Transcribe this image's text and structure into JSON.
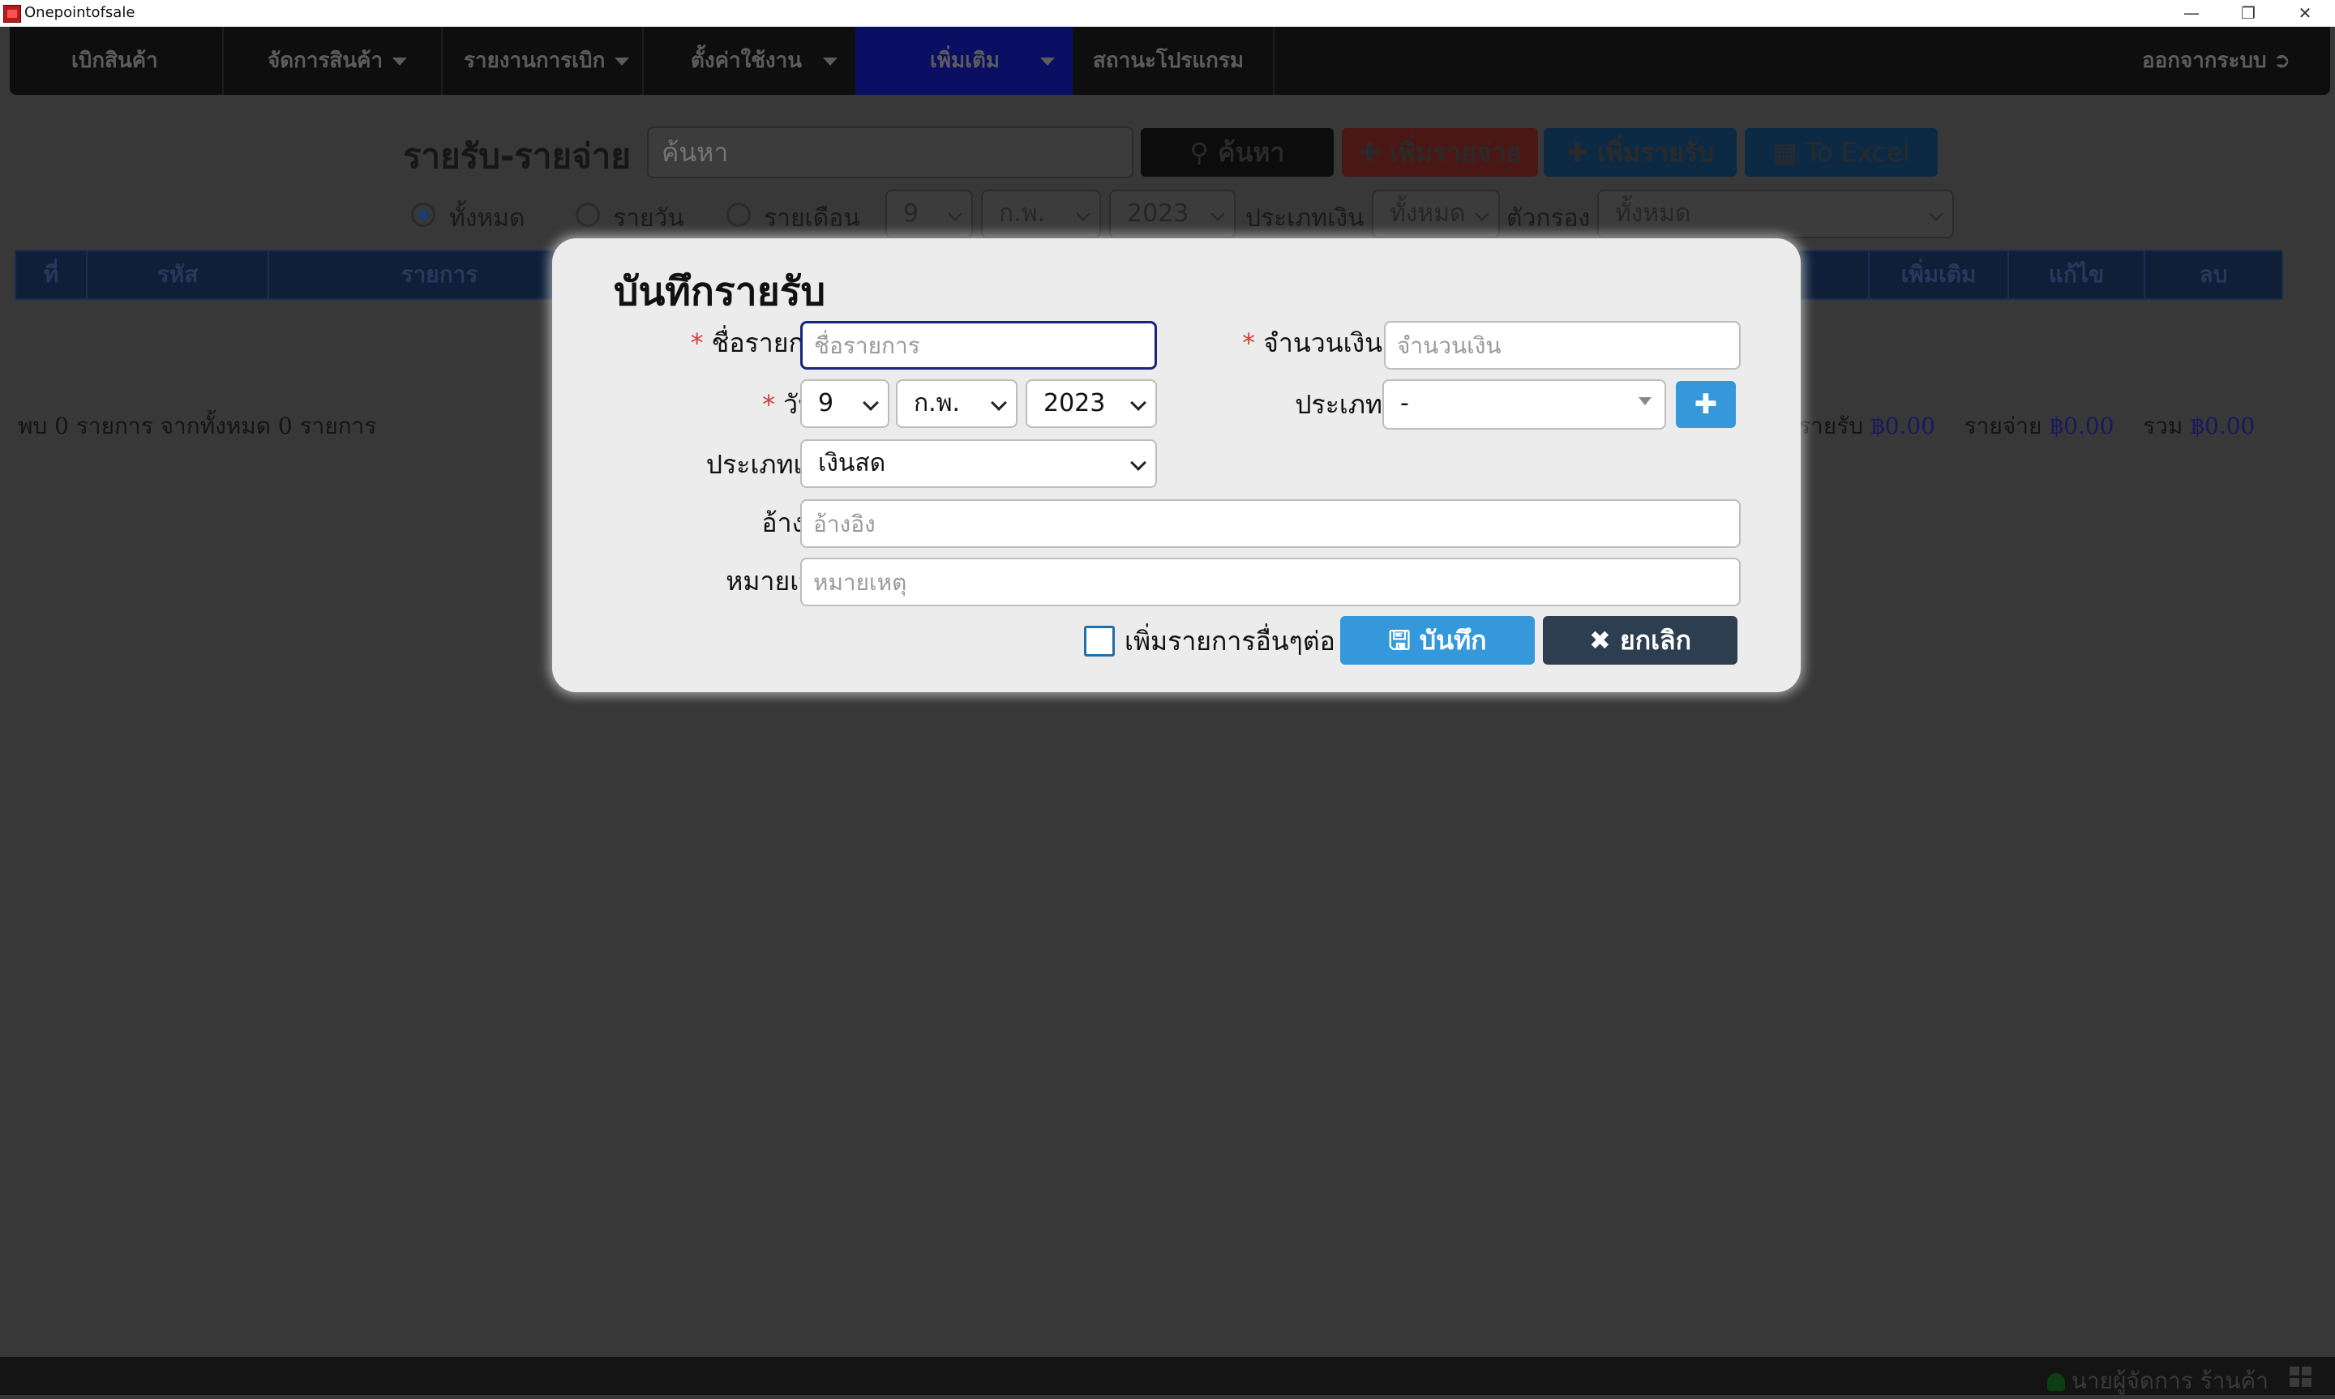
{
  "window": {
    "title": "Onepointofsale"
  },
  "nav": {
    "items": [
      {
        "label": "เบิกสินค้า"
      },
      {
        "label": "จัดการสินค้า"
      },
      {
        "label": "รายงานการเบิก"
      },
      {
        "label": "ตั้งค่าใช้งาน"
      },
      {
        "label": "เพิ่มเติม"
      },
      {
        "label": "สถานะโปรแกรม"
      }
    ],
    "logout": "ออกจากระบบ"
  },
  "page": {
    "title": "รายรับ-รายจ่าย",
    "search_placeholder": "ค้นหา",
    "search_btn": "ค้นหา",
    "add_expense_btn": "เพิ่มรายจ่าย",
    "add_income_btn": "เพิ่มรายรับ",
    "excel_btn": "To Excel",
    "filters": {
      "all": "ทั้งหมด",
      "daily": "รายวัน",
      "monthly": "รายเดือน",
      "day": "9",
      "month": "ก.พ.",
      "year": "2023",
      "money_type_label": "ประเภทเงิน",
      "money_type_value": "ทั้งหมด",
      "filter_label": "ตัวกรอง",
      "filter_value": "ทั้งหมด"
    },
    "table_headers": [
      "ที่",
      "รหัส",
      "รายการ",
      "เพิ่มเติม",
      "แก้ไข",
      "ลบ"
    ],
    "summary": {
      "found": "พบ 0 รายการ จากทั้งหมด 0 รายการ",
      "income_label": "รายรับ",
      "income_value": "฿0.00",
      "expense_label": "รายจ่าย",
      "expense_value": "฿0.00",
      "total_label": "รวม",
      "total_value": "฿0.00"
    }
  },
  "modal": {
    "title": "บันทึกรายรับ",
    "name_label": "ชื่อรายการ",
    "name_placeholder": "ชื่อรายการ",
    "amount_label": "จำนวนเงิน",
    "amount_placeholder": "จำนวนเงิน",
    "date_label": "วันที่",
    "day": "9",
    "month": "ก.พ.",
    "year": "2023",
    "category_label": "ประเภท",
    "category_value": "-",
    "money_type_label": "ประเภทเงิน",
    "money_type_value": "เงินสด",
    "reference_label": "อ้างอิง",
    "reference_placeholder": "อ้างอิง",
    "note_label": "หมายเหตุ",
    "note_placeholder": "หมายเหตุ",
    "continue_label": "เพิ่มรายการอื่นๆต่อ",
    "save_btn": "บันทึก",
    "cancel_btn": "ยกเลิก"
  },
  "status": {
    "user": "นายผู้จัดการ ร้านค้า"
  },
  "colors": {
    "primary": "#3498db",
    "danger": "#d43f3a",
    "dark": "#2c3e50",
    "nav_active": "#0a0f63"
  }
}
